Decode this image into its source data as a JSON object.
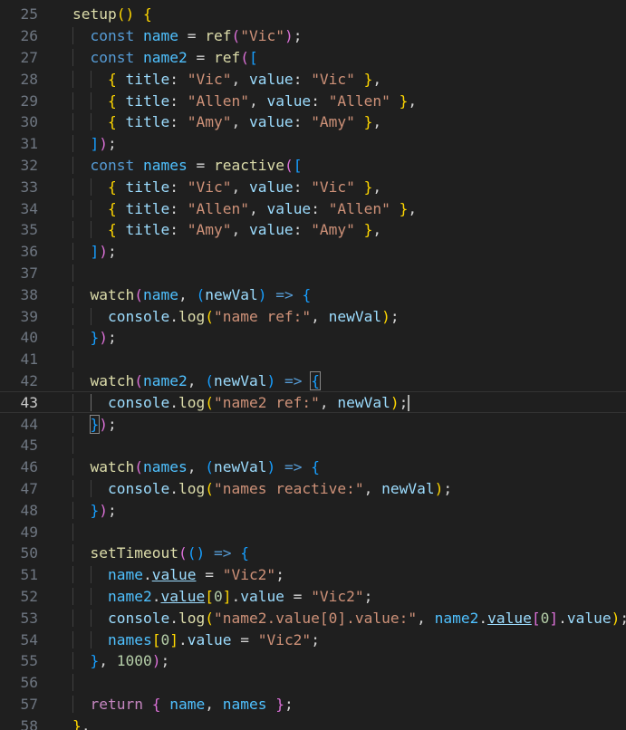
{
  "editor": {
    "language": "javascript",
    "current_line": 43,
    "lines": [
      {
        "n": "25",
        "text": "setup() {"
      },
      {
        "n": "26",
        "text": "const name = ref(\"Vic\");"
      },
      {
        "n": "27",
        "text": "const name2 = ref(["
      },
      {
        "n": "28",
        "text": "{ title: \"Vic\", value: \"Vic\" },"
      },
      {
        "n": "29",
        "text": "{ title: \"Allen\", value: \"Allen\" },"
      },
      {
        "n": "30",
        "text": "{ title: \"Amy\", value: \"Amy\" },"
      },
      {
        "n": "31",
        "text": "]);"
      },
      {
        "n": "32",
        "text": "const names = reactive(["
      },
      {
        "n": "33",
        "text": "{ title: \"Vic\", value: \"Vic\" },"
      },
      {
        "n": "34",
        "text": "{ title: \"Allen\", value: \"Allen\" },"
      },
      {
        "n": "35",
        "text": "{ title: \"Amy\", value: \"Amy\" },"
      },
      {
        "n": "36",
        "text": "]);"
      },
      {
        "n": "37",
        "text": ""
      },
      {
        "n": "38",
        "text": "watch(name, (newVal) => {"
      },
      {
        "n": "39",
        "text": "console.log(\"name ref:\", newVal);"
      },
      {
        "n": "40",
        "text": "});"
      },
      {
        "n": "41",
        "text": ""
      },
      {
        "n": "42",
        "text": "watch(name2, (newVal) => {"
      },
      {
        "n": "43",
        "text": "console.log(\"name2 ref:\", newVal);"
      },
      {
        "n": "44",
        "text": "});"
      },
      {
        "n": "45",
        "text": ""
      },
      {
        "n": "46",
        "text": "watch(names, (newVal) => {"
      },
      {
        "n": "47",
        "text": "console.log(\"names reactive:\", newVal);"
      },
      {
        "n": "48",
        "text": "});"
      },
      {
        "n": "49",
        "text": ""
      },
      {
        "n": "50",
        "text": "setTimeout(() => {"
      },
      {
        "n": "51",
        "text": "name.value = \"Vic2\";"
      },
      {
        "n": "52",
        "text": "name2.value[0].value = \"Vic2\";"
      },
      {
        "n": "53",
        "text": "console.log(\"name2.value[0].value:\", name2.value[0].value);"
      },
      {
        "n": "54",
        "text": "names[0].value = \"Vic2\";"
      },
      {
        "n": "55",
        "text": "}, 1000);"
      },
      {
        "n": "56",
        "text": ""
      },
      {
        "n": "57",
        "text": "return { name, names };"
      },
      {
        "n": "58",
        "text": "},"
      }
    ]
  }
}
